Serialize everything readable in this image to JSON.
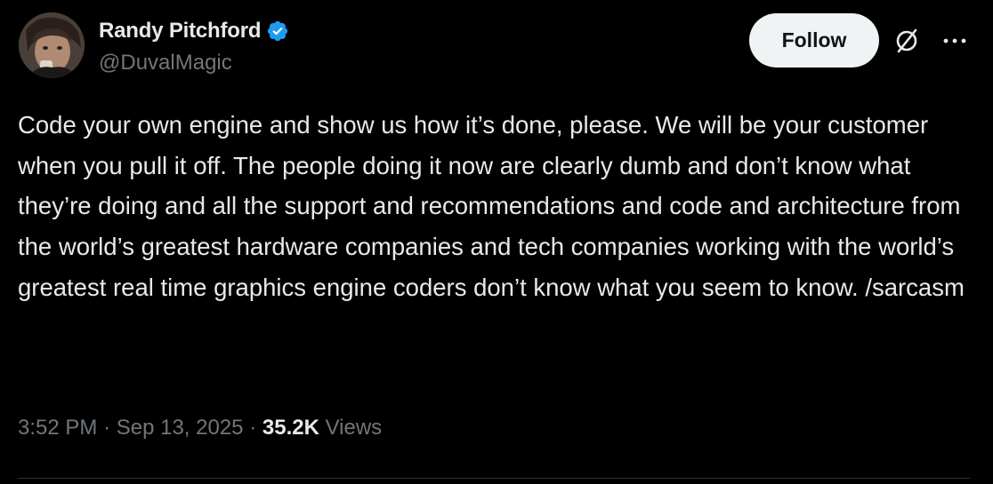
{
  "author": {
    "display_name": "Randy Pitchford",
    "handle": "@DuvalMagic",
    "verified": true,
    "verified_color": "#1d9bf0"
  },
  "actions": {
    "follow_label": "Follow",
    "grok_icon": "grok-icon",
    "more_icon": "more-options-icon"
  },
  "tweet": {
    "text": "Code your own engine and show us how it’s done, please.  We will be your customer when you pull it off. The people doing it now are clearly dumb and don’t know what they’re doing and all the support and recommendations and code and architecture from the world’s greatest hardware companies and tech companies working with the world’s greatest real time graphics engine coders don’t know what you seem to know. /sarcasm"
  },
  "meta": {
    "time": "3:52 PM",
    "separator": "·",
    "date": "Sep 13, 2025",
    "views_count": "35.2K",
    "views_label": "Views"
  },
  "colors": {
    "background": "#000000",
    "text_primary": "#e7e9ea",
    "text_secondary": "#71767b",
    "follow_bg": "#eff3f4"
  }
}
